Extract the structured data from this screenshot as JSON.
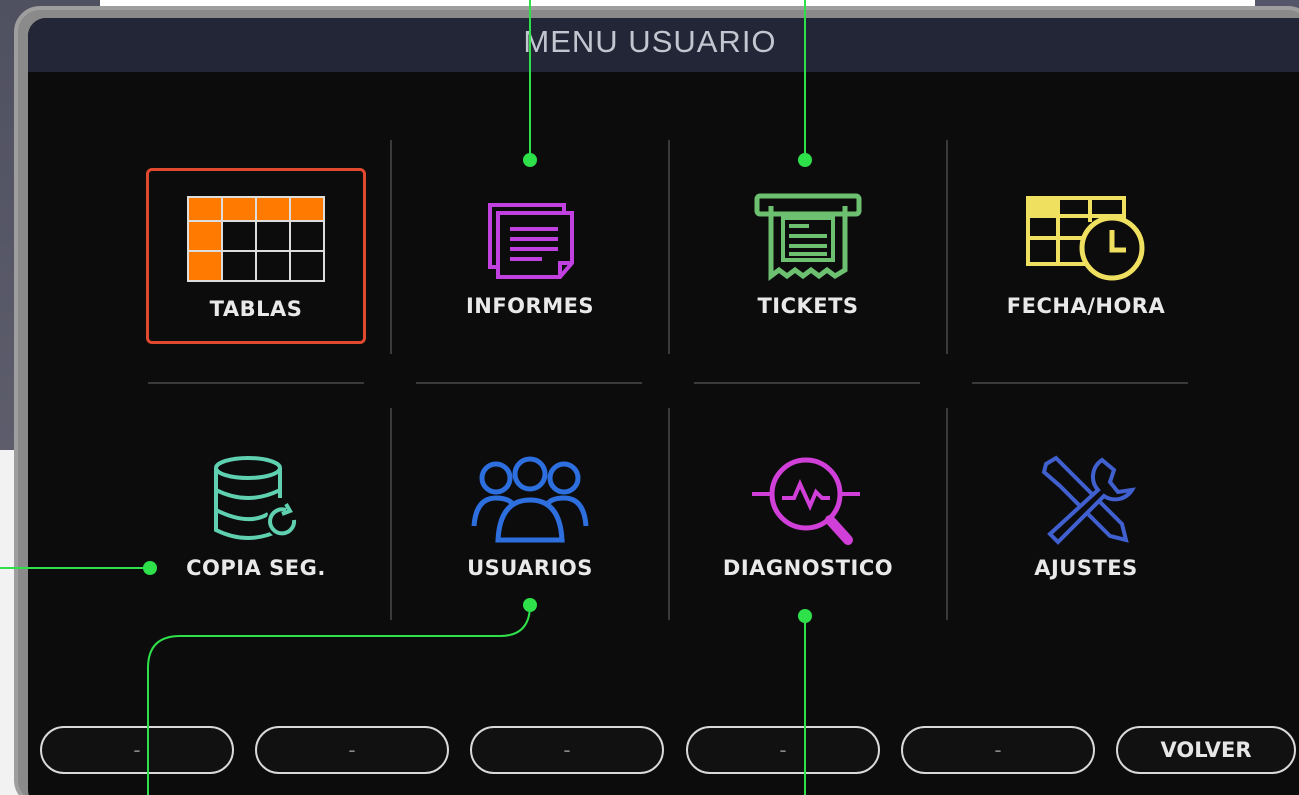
{
  "screen": {
    "title": "MENU USUARIO"
  },
  "menu": {
    "items": [
      {
        "id": "tablas",
        "label": "TABLAS",
        "icon": "table-icon",
        "color": "#ff7a00",
        "selected": true
      },
      {
        "id": "informes",
        "label": "INFORMES",
        "icon": "report-icon",
        "color": "#c040e0",
        "selected": false
      },
      {
        "id": "tickets",
        "label": "TICKETS",
        "icon": "ticket-printer-icon",
        "color": "#6cc070",
        "selected": false
      },
      {
        "id": "fecha_hora",
        "label": "FECHA/HORA",
        "icon": "calendar-clock-icon",
        "color": "#f0e060",
        "selected": false
      },
      {
        "id": "copia_seg",
        "label": "COPIA SEG.",
        "icon": "database-backup-icon",
        "color": "#5fd0b0",
        "selected": false
      },
      {
        "id": "usuarios",
        "label": "USUARIOS",
        "icon": "users-group-icon",
        "color": "#2e6fe0",
        "selected": false
      },
      {
        "id": "diagnostico",
        "label": "DIAGNOSTICO",
        "icon": "diagnostic-magnifier-icon",
        "color": "#d040d8",
        "selected": false
      },
      {
        "id": "ajustes",
        "label": "AJUSTES",
        "icon": "wrench-screwdriver-icon",
        "color": "#4060d0",
        "selected": false
      }
    ]
  },
  "footer": {
    "buttons": [
      "-",
      "-",
      "-",
      "-",
      "-",
      "VOLVER"
    ]
  },
  "colors": {
    "selection_border": "#e0492e",
    "annotation_line": "#2ee04a",
    "background": "#0c0c0c",
    "titlebar": "#232636"
  }
}
